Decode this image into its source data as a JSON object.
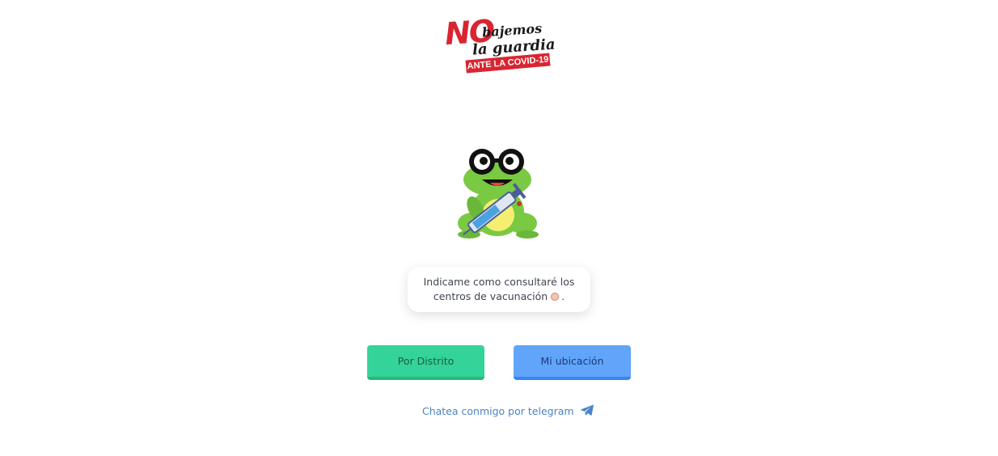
{
  "logo": {
    "line1_no": "NO",
    "line1_rest": "bajemos",
    "line2": "la guardia",
    "band": "ANTE LA COVID-19"
  },
  "mascot": {
    "icon": "frog-with-syringe-icon"
  },
  "message": {
    "line1": "Indicame como consultaré los",
    "line2": "centros de vacunación",
    "suffix": "."
  },
  "buttons": {
    "por_distrito": "Por Distrito",
    "mi_ubicacion": "Mi ubicación"
  },
  "telegram": {
    "label": "Chatea conmigo por telegram",
    "icon": "telegram-plane-icon"
  },
  "colors": {
    "green_button": "#34d399",
    "blue_button": "#60a5fa",
    "brand_red": "#d92531",
    "link": "#4a83c9"
  }
}
